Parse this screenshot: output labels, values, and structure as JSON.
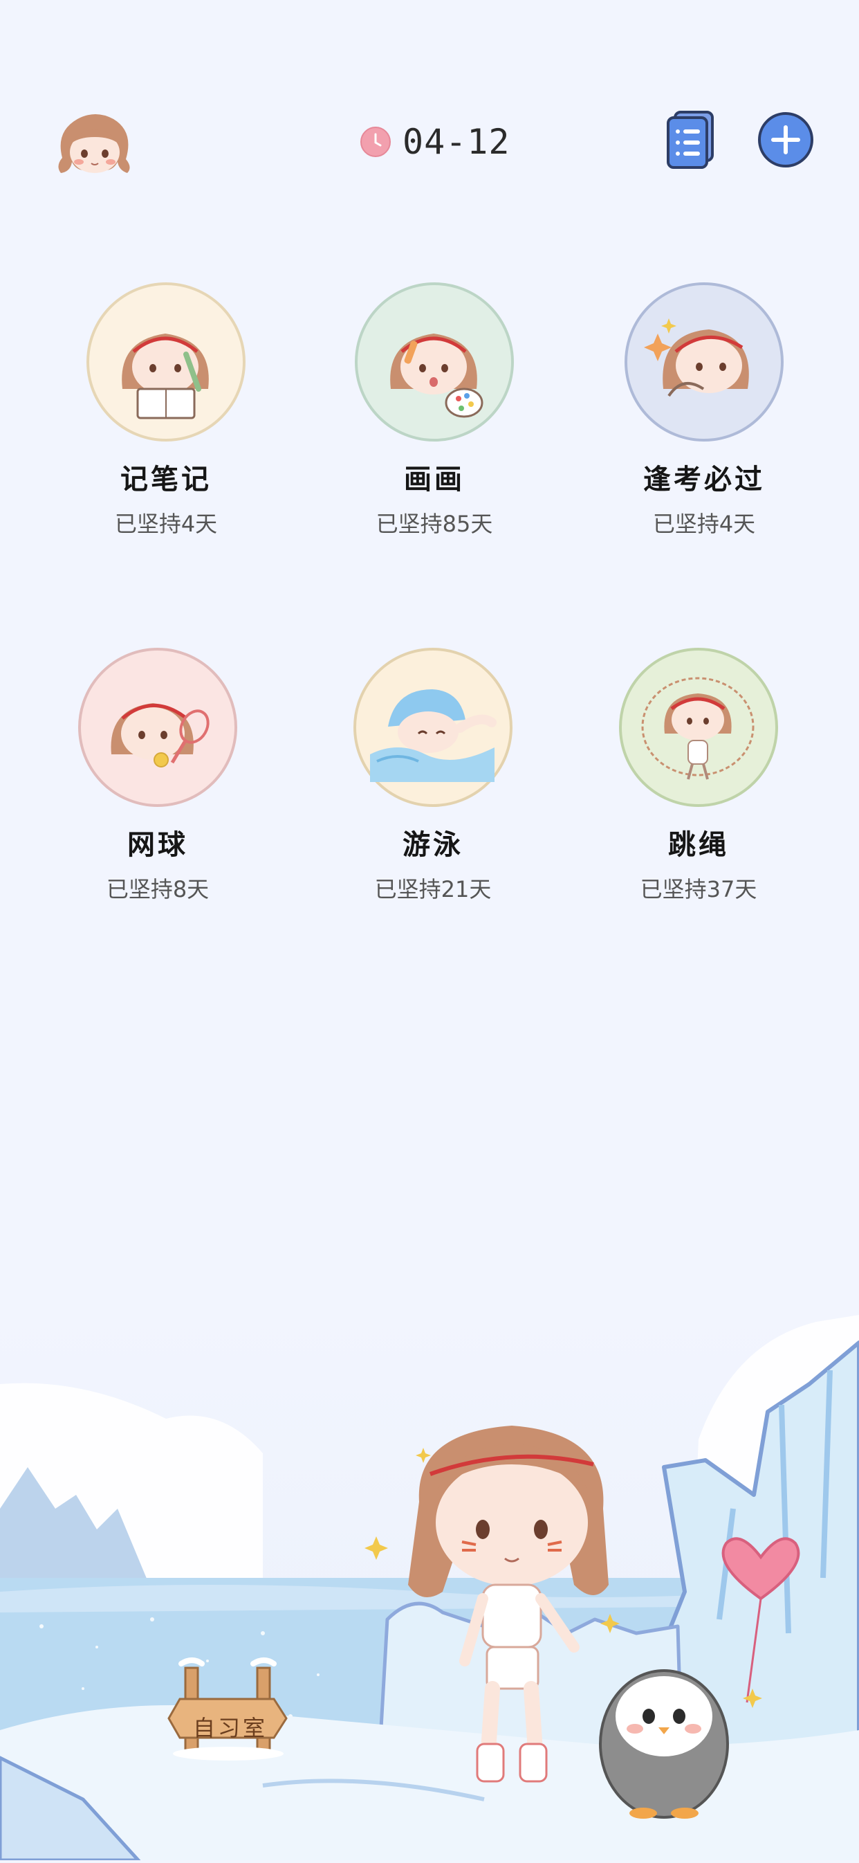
{
  "header": {
    "date": "04-12",
    "icons": {
      "avatar": "girl-avatar-icon",
      "clock": "clock-icon",
      "list": "task-list-icon",
      "add": "plus-icon"
    }
  },
  "habits": [
    {
      "name": "记笔记",
      "days": "已坚持4天",
      "ring": "#e6d6b5",
      "fill": "#fcf2e2",
      "icon": "note-taking-girl-icon"
    },
    {
      "name": "画画",
      "days": "已坚持85天",
      "ring": "#bcd5c6",
      "fill": "#e1efe6",
      "icon": "painting-girl-icon"
    },
    {
      "name": "逢考必过",
      "days": "已坚持4天",
      "ring": "#aebad8",
      "fill": "#dfe5f4",
      "icon": "exam-girl-icon"
    },
    {
      "name": "网球",
      "days": "已坚持8天",
      "ring": "#e1bcbc",
      "fill": "#fbe5e3",
      "icon": "tennis-girl-icon"
    },
    {
      "name": "游泳",
      "days": "已坚持21天",
      "ring": "#e3d2ae",
      "fill": "#fcf0dc",
      "icon": "swimming-girl-icon"
    },
    {
      "name": "跳绳",
      "days": "已坚持37天",
      "ring": "#bfd3a9",
      "fill": "#e6f0d9",
      "icon": "jump-rope-girl-icon"
    }
  ],
  "scene": {
    "sign": "自习室",
    "illustration": "girl-and-penguin-ice-scene"
  },
  "colors": {
    "background": "#f2f5fe",
    "accent_blue": "#5b8de8",
    "clock_pink": "#f2a0ae"
  }
}
